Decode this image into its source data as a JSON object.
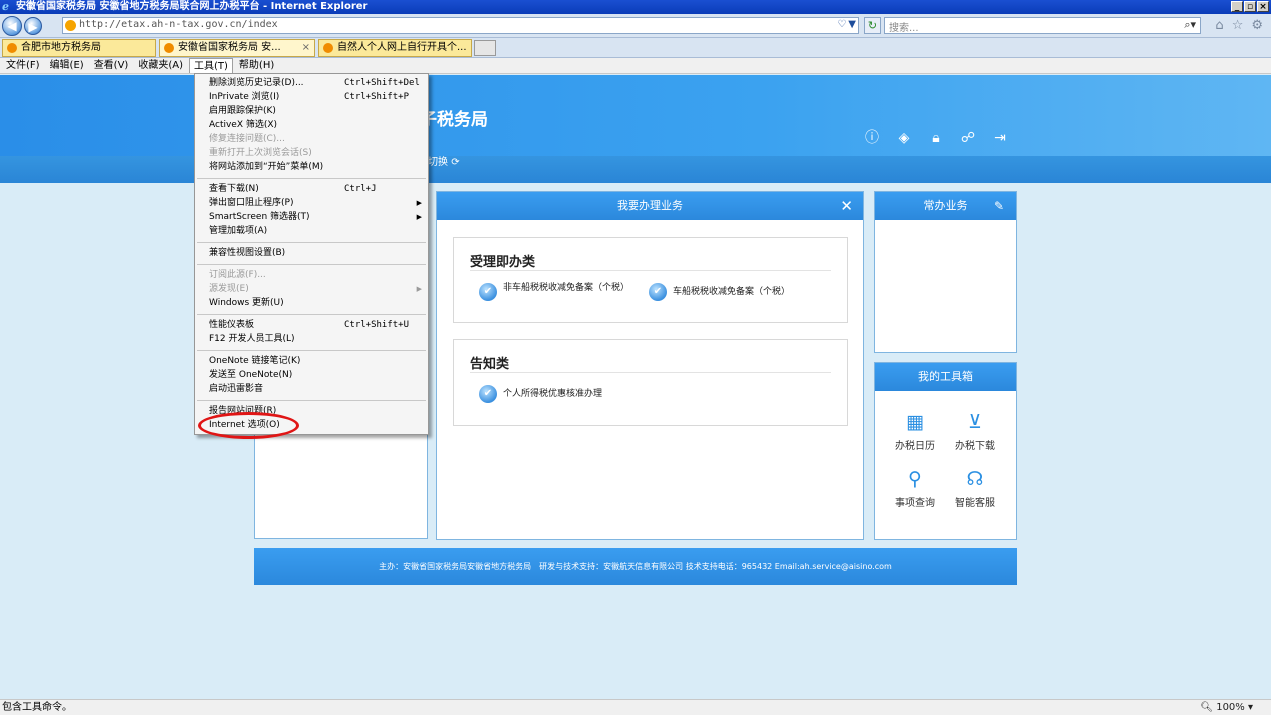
{
  "window": {
    "title": "安徽省国家税务局 安徽省地方税务局联合网上办税平台 - Internet Explorer"
  },
  "address": {
    "url": "http://etax.ah-n-tax.gov.cn/index",
    "search_placeholder": "搜索..."
  },
  "tabs": [
    {
      "label": "合肥市地方税务局"
    },
    {
      "label": "安徽省国家税务局 安...",
      "close": "×"
    },
    {
      "label": "自然人个人网上自行开具个..."
    }
  ],
  "menubar": [
    "文件(F)",
    "编辑(E)",
    "查看(V)",
    "收藏夹(A)",
    "工具(T)",
    "帮助(H)"
  ],
  "tools_menu": {
    "items": [
      {
        "label": "删除浏览历史记录(D)...",
        "shortcut": "Ctrl+Shift+Del"
      },
      {
        "label": "InPrivate 浏览(I)",
        "shortcut": "Ctrl+Shift+P"
      },
      {
        "label": "启用跟踪保护(K)"
      },
      {
        "label": "ActiveX 筛选(X)"
      },
      {
        "label": "修复连接问题(C)...",
        "disabled": true
      },
      {
        "label": "重新打开上次浏览会话(S)",
        "disabled": true
      },
      {
        "label": "将网站添加到“开始”菜单(M)"
      },
      {
        "label": "查看下载(N)",
        "shortcut": "Ctrl+J"
      },
      {
        "label": "弹出窗口阻止程序(P)",
        "arrow": "▶"
      },
      {
        "label": "SmartScreen 筛选器(T)",
        "arrow": "▶"
      },
      {
        "label": "管理加载项(A)"
      },
      {
        "label": "兼容性视图设置(B)"
      },
      {
        "label": "订阅此源(F)...",
        "disabled": true
      },
      {
        "label": "源发现(E)",
        "disabled": true,
        "arrow": "▶"
      },
      {
        "label": "Windows 更新(U)"
      },
      {
        "label": "性能仪表板",
        "shortcut": "Ctrl+Shift+U"
      },
      {
        "label": "F12 开发人员工具(L)"
      },
      {
        "label": "OneNote 链接笔记(K)"
      },
      {
        "label": "发送至 OneNote(N)"
      },
      {
        "label": "启动迅雷影音"
      },
      {
        "label": "报告网站问题(R)"
      },
      {
        "label": "Internet 选项(O)"
      }
    ]
  },
  "header": {
    "site_title": "子税务局",
    "nav_switch": "切换"
  },
  "main_panel": {
    "title": "我要办理业务",
    "close": "✕",
    "categories": [
      {
        "title": "受理即办类",
        "services": [
          "非车船税税收减免备案（个税）",
          "车船税税收减免备案（个税）"
        ]
      },
      {
        "title": "告知类",
        "services": [
          "个人所得税优惠核准办理"
        ]
      }
    ]
  },
  "common_panel": {
    "title": "常办业务"
  },
  "toolbox_panel": {
    "title": "我的工具箱",
    "tools": [
      {
        "label": "办税日历",
        "icon": "calendar-icon"
      },
      {
        "label": "办税下载",
        "icon": "download-icon"
      },
      {
        "label": "事项查询",
        "icon": "search-icon"
      },
      {
        "label": "智能客服",
        "icon": "headset-icon"
      }
    ]
  },
  "footer": {
    "text": "主办：安徽省国家税务局安徽省地方税务局　研发与技术支持：安徽航天信息有限公司 技术支持电话：965432 Email:ah.service@aisino.com"
  },
  "statusbar": {
    "text": "包含工具命令。",
    "zoom": "100%"
  }
}
